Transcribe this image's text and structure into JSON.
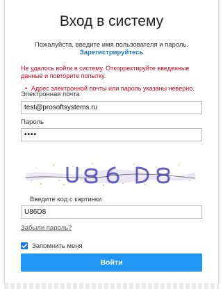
{
  "header": {
    "title": "Вход в систему",
    "subtitle": "Пожалуйста, введите имя пользователя и пароль.",
    "register_link": "Зарегистрируйтесь"
  },
  "errors": {
    "main": "Не удалось войти в систему. Откорректируйте введенные данные и повторите попытку.",
    "items": [
      "Адрес электронной почты или пароль указаны неверно."
    ]
  },
  "form": {
    "email_label": "Электронная почта",
    "email_value": "test@prosoftsystems.ru",
    "password_label": "Пароль",
    "password_value": "••••",
    "captcha_text": "U86D8",
    "captcha_label": "Введите код с картинки",
    "captcha_value": "U86D8",
    "forgot_link": "Забыли пароль?",
    "remember_label": "Запомнить меня",
    "remember_checked": true,
    "submit_label": "Войти"
  },
  "colors": {
    "accent": "#2196f3",
    "link": "#1a73c8",
    "error": "#d0021b",
    "checkbox": "#1a73e8"
  }
}
